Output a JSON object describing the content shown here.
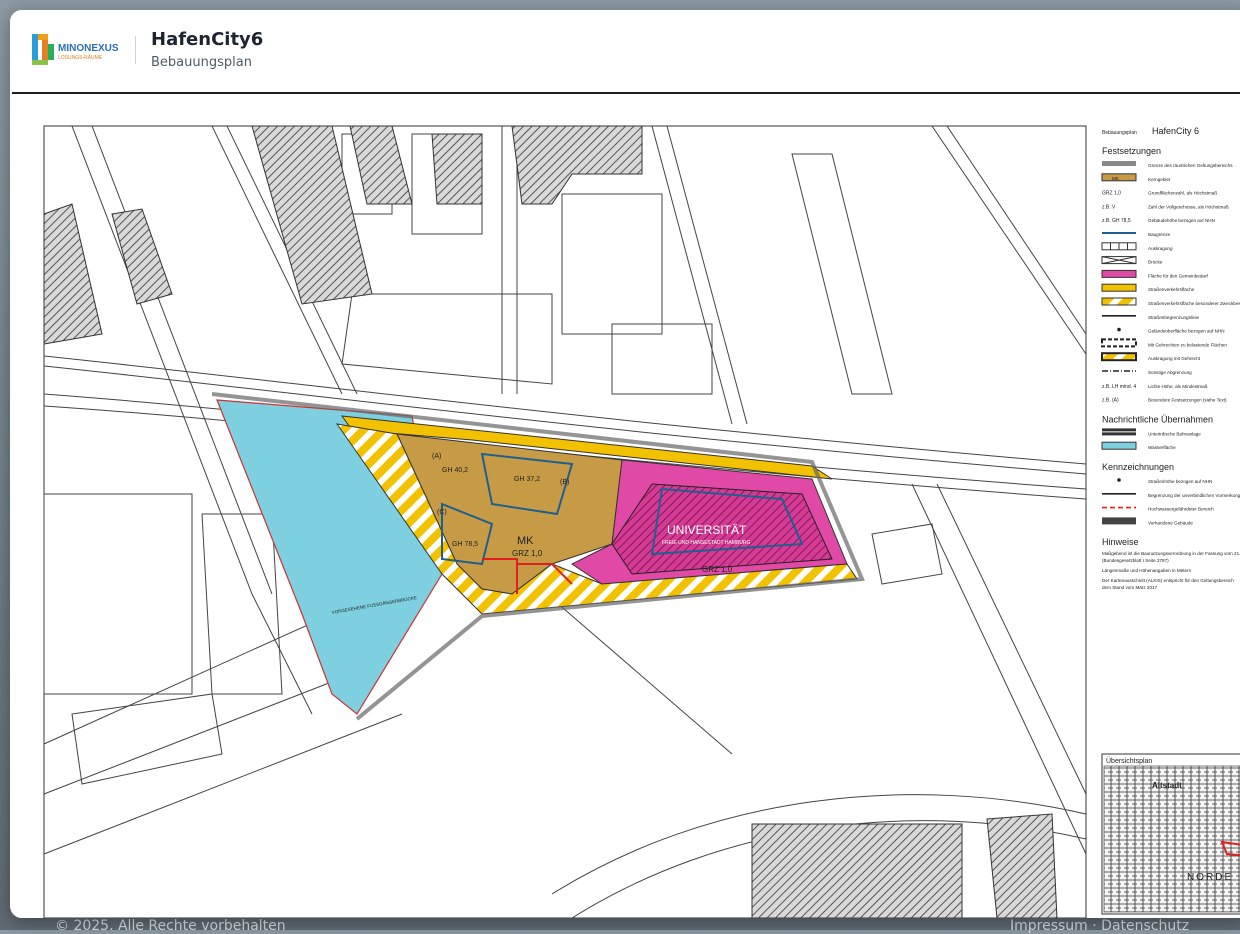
{
  "app": {
    "logo_text": "MINONEXUS",
    "logo_sub": "LÖSUNGS-RÄUME",
    "title": "HafenCity6",
    "subtitle": "Bebauungsplan"
  },
  "backdrop": {
    "left": "© 2025. Alle Rechte vorbehalten",
    "right": "Impressum · Datenschutz"
  },
  "plan": {
    "sheet_prefix": "Bebauungsplan",
    "sheet_name": "HafenCity 6",
    "festsetzungen_heading": "Festsetzungen",
    "festsetzungen": [
      {
        "sym": "grey-line",
        "code": "",
        "text": "Grenze des räumlichen Geltungsbereichs"
      },
      {
        "sym": "mk-box",
        "code": "MK",
        "text": "Kerngebiet"
      },
      {
        "sym": "text",
        "code": "GRZ 1,0",
        "text": "Grundflächenzahl, als Höchstmaß"
      },
      {
        "sym": "text",
        "code": "z.B. V",
        "text": "Zahl der Vollgeschosse, als Höchstmaß"
      },
      {
        "sym": "text",
        "code": "z.B. GH 78,5",
        "text": "Gebäudehöhe bezogen auf NHN"
      },
      {
        "sym": "blue-line",
        "code": "",
        "text": "Baugrenze"
      },
      {
        "sym": "ausk",
        "code": "",
        "text": "Auskragung"
      },
      {
        "sym": "bridge",
        "code": "",
        "text": "Brücke"
      },
      {
        "sym": "magenta",
        "code": "",
        "text": "Fläche für den Gemeinbedarf"
      },
      {
        "sym": "yellow",
        "code": "",
        "text": "Straßenverkehrsfläche"
      },
      {
        "sym": "yellow-hatch",
        "code": "",
        "text": "Straßenverkehrsfläche besonderer Zweckbestimmung"
      },
      {
        "sym": "black-line",
        "code": "",
        "text": "Straßenbegrenzungslinie"
      },
      {
        "sym": "dot",
        "code": "",
        "text": "Geländeoberfläche bezogen auf NHN"
      },
      {
        "sym": "dash-box",
        "code": "",
        "text": "Mit Gehrechten zu belastende Flächen"
      },
      {
        "sym": "hatch-box",
        "code": "",
        "text": "Auskragung mit Gehrecht"
      },
      {
        "sym": "dashdot",
        "code": "",
        "text": "Sonstige Abgrenzung"
      },
      {
        "sym": "text",
        "code": "z.B. LH mind. 4",
        "text": "Lichte Höhe, als Mindestmaß"
      },
      {
        "sym": "text",
        "code": "z.B. (A)",
        "text": "Besondere Festsetzungen (siehe Text)"
      }
    ],
    "nachrichtlich_heading": "Nachrichtliche Übernahmen",
    "nachrichtlich": [
      {
        "sym": "rail",
        "text": "Unterirdische Bahnanlage"
      },
      {
        "sym": "water",
        "text": "Wasserfläche"
      }
    ],
    "kennzeichnungen_heading": "Kennzeichnungen",
    "kennzeichnungen": [
      {
        "sym": "dot",
        "text": "Straßenhöhe bezogen auf NHN"
      },
      {
        "sym": "black-line",
        "text": "Begrenzung der unverbindlichen Vormerkung"
      },
      {
        "sym": "red-dash",
        "text": "Hochwassergefährdeter Bereich"
      },
      {
        "sym": "grey-box",
        "text": "Vorhandene Gebäude"
      }
    ],
    "hinweise_heading": "Hinweise",
    "hinweise": [
      "Maßgebend ist die Baunutzungsverordnung in der Fassung vom 21. November 2017",
      "(Bundesgesetzblatt I Seite 3787)",
      "Längenmaße und Höhenangaben in Metern",
      "Der Kartenausschnitt (ALKIS) entspricht für den Geltungsbereich",
      "dem Stand vom März 2017"
    ],
    "overview_title": "Übersichtsplan",
    "overview_labels": {
      "altstadt": "Altstadt",
      "norden": "NORDE"
    },
    "map_labels": {
      "mk": "MK",
      "grz": "GRZ 1,0",
      "grz_uni": "GRZ 1,0",
      "gh402": "GH 40,2",
      "gh372": "GH 37,2",
      "gh785": "GH 78,5",
      "a": "(A)",
      "b": "(B)",
      "c": "(C)",
      "uni": "UNIVERSITÄT",
      "uni_sub": "FREIE UND HANSESTADT HAMBURG",
      "bridge": "VORGESEHENE FUSSGÄNGERBRÜCKE"
    }
  }
}
